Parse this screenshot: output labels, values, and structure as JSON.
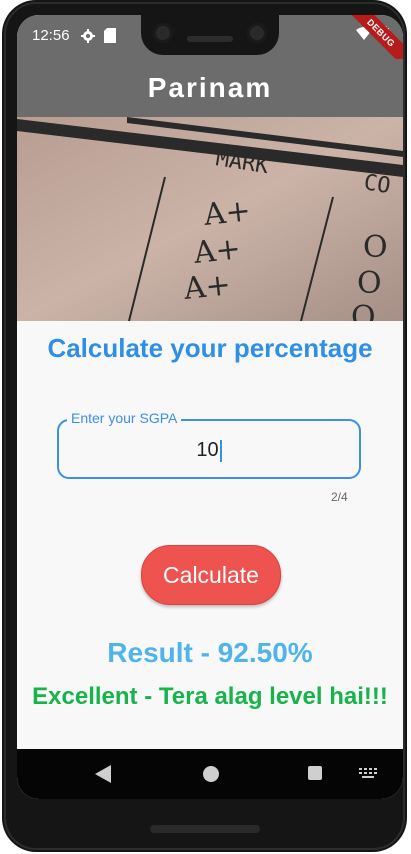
{
  "status_bar": {
    "time": "12:56",
    "debug_banner": "DEBUG"
  },
  "app_bar": {
    "title": "Parinam"
  },
  "hero": {
    "header_text": "MARK",
    "header_text_2": "CO",
    "grades": [
      "A+",
      "A+",
      "A+"
    ],
    "marks": [
      "O",
      "O",
      "O"
    ]
  },
  "main": {
    "headline": "Calculate your percentage",
    "sgpa_field": {
      "label": "Enter your SGPA",
      "value": "10",
      "counter": "2/4"
    },
    "calculate_button": "Calculate",
    "result": "Result - 92.50%",
    "remark": "Excellent - Tera alag level hai!!!"
  },
  "colors": {
    "accent": "#2f8fe6",
    "button": "#ef5350",
    "result": "#4fb3ec",
    "remark": "#17b34b",
    "app_bar": "#6c6c6c"
  }
}
